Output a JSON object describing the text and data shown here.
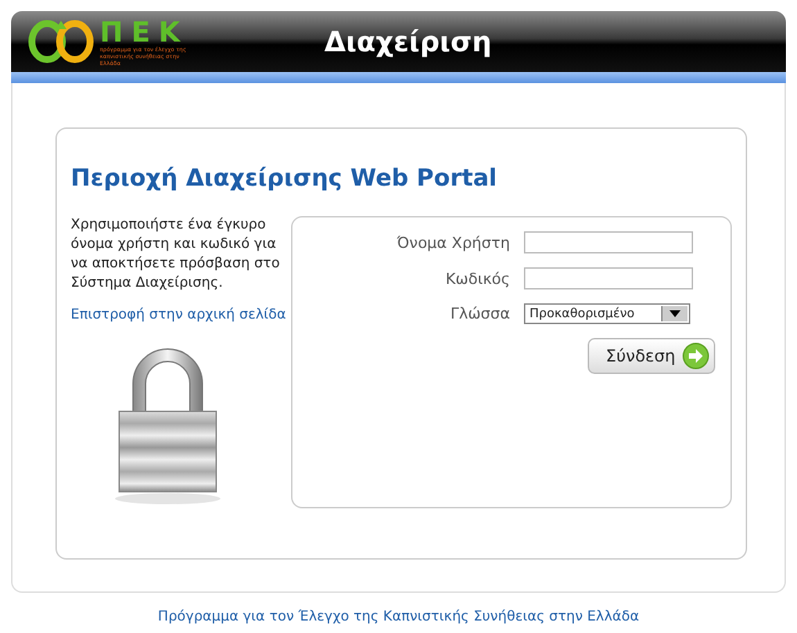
{
  "header": {
    "logo_text": "ΠΕΚ",
    "logo_tagline": "πρόγραμμα για τον έλεγχο της καπνιστικής συνήθειας στην Ελλάδα",
    "title": "Διαχείριση"
  },
  "panel": {
    "title": "Περιοχή Διαχείρισης Web Portal",
    "instructions": "Χρησιμοποιήστε ένα έγκυρο όνομα χρήστη και κωδικό για να αποκτήσετε πρόσβαση στο Σύστημα Διαχείρισης.",
    "home_link": "Επιστροφή στην αρχική σελίδα"
  },
  "form": {
    "fields": [
      {
        "kind": "text",
        "label": "Όνομα Χρήστη"
      },
      {
        "kind": "password",
        "label": "Κωδικός"
      },
      {
        "kind": "select",
        "label": "Γλώσσα",
        "value": "Προκαθορισμένο"
      }
    ],
    "submit": "Σύνδεση"
  },
  "footer": "Πρόγραμμα για τον Έλεγχο της Καπνιστικής Συνήθειας στην Ελλάδα"
}
